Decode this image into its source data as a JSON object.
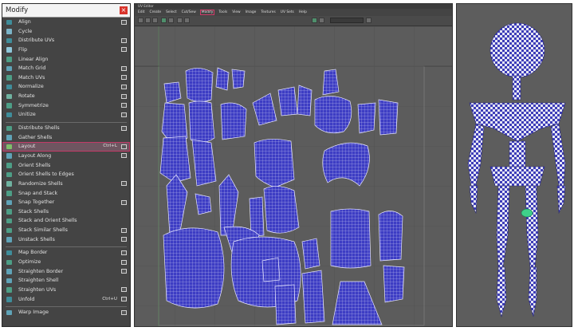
{
  "menu": {
    "title": "Modify",
    "close_label": "×",
    "items": [
      {
        "label": "Align",
        "opt": true,
        "color": "#3f8d9a"
      },
      {
        "label": "Cycle",
        "opt": false,
        "color": "#7bb4c8"
      },
      {
        "label": "Distribute UVs",
        "opt": true,
        "color": "#3f8d9a"
      },
      {
        "label": "Flip",
        "opt": true,
        "color": "#8ec7da"
      },
      {
        "label": "Linear Align",
        "opt": false,
        "color": "#4d9e86"
      },
      {
        "label": "Match Grid",
        "opt": true,
        "color": "#5fa3b7"
      },
      {
        "label": "Match UVs",
        "opt": true,
        "color": "#4d9e86"
      },
      {
        "label": "Normalize",
        "opt": true,
        "color": "#3f8d9a"
      },
      {
        "label": "Rotate",
        "opt": true,
        "color": "#6fb2a0"
      },
      {
        "label": "Symmetrize",
        "opt": true,
        "color": "#4d9e86"
      },
      {
        "label": "Unitize",
        "opt": true,
        "color": "#3f8d9a"
      },
      {
        "sep": true
      },
      {
        "label": "Distribute Shells",
        "opt": true,
        "color": "#4d9e86"
      },
      {
        "label": "Gather Shells",
        "opt": false,
        "color": "#5fa3b7"
      },
      {
        "label": "Layout",
        "opt": true,
        "color": "#7fbf6a",
        "shortcut": "Ctrl+L",
        "highlight": true
      },
      {
        "label": "Layout Along",
        "opt": true,
        "color": "#5fa3b7"
      },
      {
        "label": "Orient Shells",
        "opt": false,
        "color": "#4d9e86"
      },
      {
        "label": "Orient Shells to Edges",
        "opt": false,
        "color": "#4d9e86"
      },
      {
        "label": "Randomize Shells",
        "opt": true,
        "color": "#6fb2a0"
      },
      {
        "label": "Snap and Stack",
        "opt": false,
        "color": "#4d9e86"
      },
      {
        "label": "Snap Together",
        "opt": true,
        "color": "#5fa3b7"
      },
      {
        "label": "Stack Shells",
        "opt": false,
        "color": "#4d9e86"
      },
      {
        "label": "Stack and Orient Shells",
        "opt": false,
        "color": "#4d9e86"
      },
      {
        "label": "Stack Similar Shells",
        "opt": true,
        "color": "#4d9e86"
      },
      {
        "label": "Unstack Shells",
        "opt": true,
        "color": "#5fa3b7"
      },
      {
        "sep": true
      },
      {
        "label": "Map Border",
        "opt": true,
        "color": "#3f8d9a"
      },
      {
        "label": "Optimize",
        "opt": true,
        "color": "#4d9e86"
      },
      {
        "label": "Straighten Border",
        "opt": true,
        "color": "#5fa3b7"
      },
      {
        "label": "Straighten Shell",
        "opt": false,
        "color": "#5fa3b7"
      },
      {
        "label": "Straighten UVs",
        "opt": true,
        "color": "#4d9e86"
      },
      {
        "label": "Unfold",
        "opt": true,
        "color": "#3f8d9a",
        "shortcut": "Ctrl+U"
      },
      {
        "sep": true
      },
      {
        "label": "Warp Image",
        "opt": true,
        "color": "#5fa3b7"
      }
    ]
  },
  "uv_editor": {
    "title": "UV Editor",
    "menubar": [
      {
        "label": "Edit"
      },
      {
        "label": "Create"
      },
      {
        "label": "Select"
      },
      {
        "label": "Cut/Sew"
      },
      {
        "label": "Modify",
        "selected": true
      },
      {
        "label": "Tools"
      },
      {
        "label": "View"
      },
      {
        "label": "Image"
      },
      {
        "label": "Textures"
      },
      {
        "label": "UV Sets"
      },
      {
        "label": "Help"
      }
    ],
    "search_placeholder": "",
    "colors": {
      "shell_fill": "#3d3dc4",
      "shell_line": "#d7d7f5",
      "grid": "#4a4a4a",
      "frame": "#7a7a7a"
    }
  },
  "preview": {
    "colors": {
      "checker_dark": "#3d3db8",
      "checker_light": "#e6e6f4",
      "selected": "#3fd08a"
    }
  }
}
